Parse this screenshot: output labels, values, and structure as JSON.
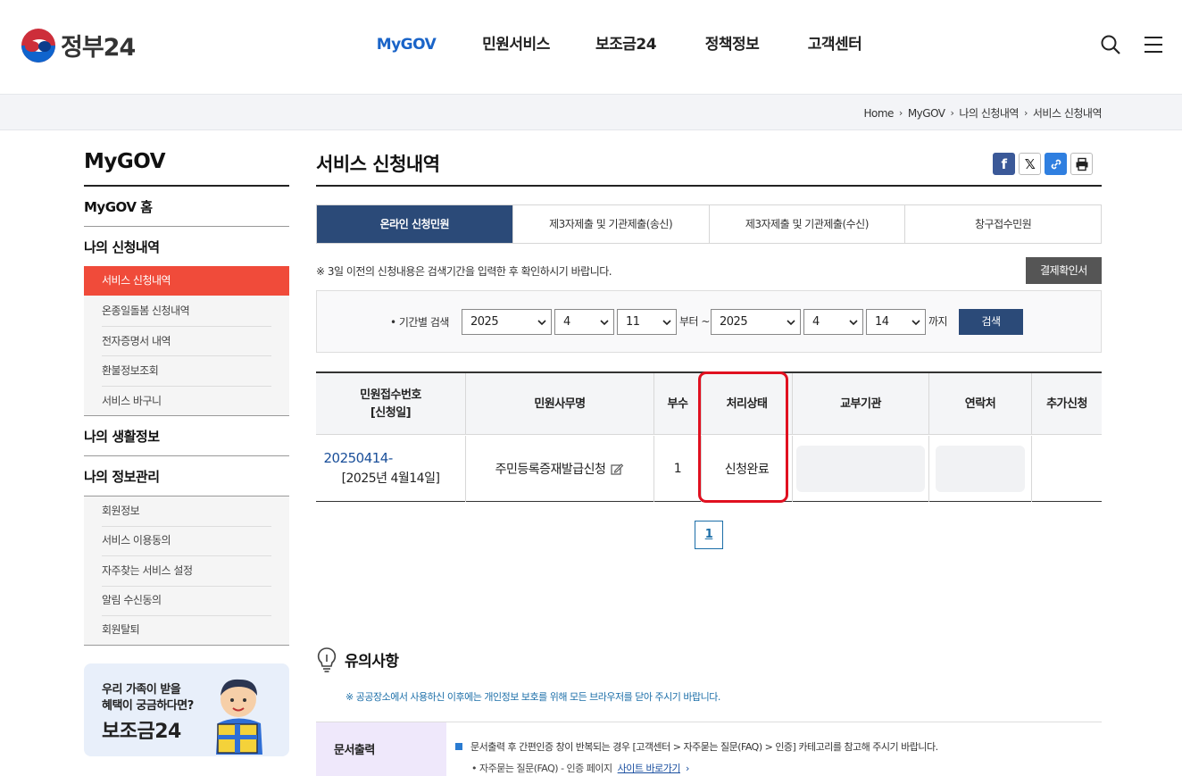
{
  "header": {
    "logo_text": "정부24",
    "nav": [
      {
        "label": "MyGOV",
        "active": true
      },
      {
        "label": "민원서비스",
        "active": false
      },
      {
        "label": "보조금24",
        "active": false
      },
      {
        "label": "정책정보",
        "active": false
      },
      {
        "label": "고객센터",
        "active": false
      }
    ],
    "icons": [
      "search-icon",
      "menu-icon"
    ],
    "accent_color": "#1a64c8"
  },
  "breadcrumb": [
    "Home",
    "MyGOV",
    "나의 신청내역",
    "서비스 신청내역"
  ],
  "sidebar": {
    "title": "MyGOV",
    "home_label": "MyGOV 홈",
    "section1": "나의 신청내역",
    "section1_items": [
      "서비스 신청내역",
      "온종일돌봄 신청내역",
      "전자증명서 내역",
      "환불정보조회",
      "서비스 바구니"
    ],
    "section2": "나의 생활정보",
    "section3": "나의 정보관리",
    "section3_items": [
      "회원정보",
      "서비스 이용동의",
      "자주찾는 서비스 설정",
      "알림 수신동의",
      "회원탈퇴"
    ],
    "active_color": "#f04b3a",
    "banner": {
      "line1": "우리 가족이 받을",
      "line2": "혜택이 궁금하다면?",
      "line3": "보조금24"
    }
  },
  "main": {
    "title": "서비스 신청내역",
    "share_icons": [
      "facebook-icon",
      "x-icon",
      "link-icon",
      "print-icon"
    ],
    "tabs": [
      {
        "label": "온라인 신청민원",
        "active": true
      },
      {
        "label": "제3자제출 및 기관제출(송신)",
        "active": false
      },
      {
        "label": "제3자제출 및 기관제출(수신)",
        "active": false
      },
      {
        "label": "창구접수민원",
        "active": false
      }
    ],
    "notice": "※ 3일 이전의 신청내용은 검색기간을 입력한 후 확인하시기 바랍니다.",
    "approval_button": "결제확인서",
    "search": {
      "label": "• 기간별 검색",
      "from_year": "2025",
      "from_month": "4",
      "from_day": "11",
      "from_suffix": "부터 ~",
      "to_year": "2025",
      "to_month": "4",
      "to_day": "14",
      "to_suffix": "까지",
      "button": "검색"
    },
    "table": {
      "headers": [
        "민원접수번호\n[신청일]",
        "민원사무명",
        "부수",
        "처리상태",
        "교부기관",
        "연락처",
        "추가신청"
      ],
      "rows": [
        {
          "receipt_no": "20250414-",
          "date": "[2025년 4월14일]",
          "service": "주민등록증재발급신청",
          "copies": "1",
          "status": "신청완료",
          "agency": "",
          "contact": "",
          "extra": ""
        }
      ]
    },
    "pagination": [
      "1"
    ],
    "notes": {
      "title": "유의사항",
      "subtitle": "※ 공공장소에서 사용하신 이후에는 개인정보 보호를 위해 모든 브라우저를 닫아 주시기 바랍니다.",
      "row_label": "문서출력",
      "row_text1": "문서출력 후 간편인증 창이 반복되는 경우 [고객센터 > 자주묻는 질문(FAQ) > 인증] 카테고리를 참고해 주시기 바랍니다.",
      "row_text2": "• 자주묻는 질문(FAQ) - 인증 페이지",
      "row_link": "사이트 바로가기"
    },
    "dark_color": "#2b4a78"
  }
}
